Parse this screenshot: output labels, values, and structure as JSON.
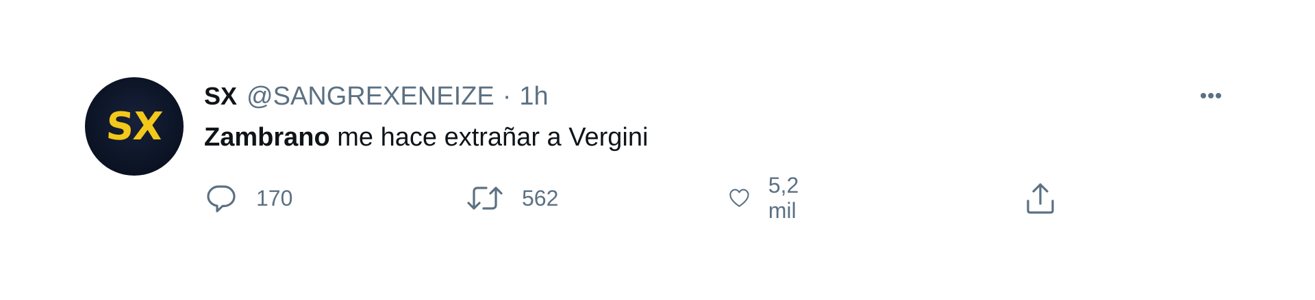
{
  "tweet": {
    "avatar_text": "SX",
    "display_name": "SX",
    "handle": "@SANGREXENEIZE",
    "separator": "·",
    "time": "1h",
    "body_bold": "Zambrano",
    "body_rest": " me hace extrañar a Vergini"
  },
  "actions": {
    "replies": "170",
    "retweets": "562",
    "likes": "5,2 mil"
  },
  "icons": {
    "more": "more-horizontal-icon",
    "reply": "reply-icon",
    "retweet": "retweet-icon",
    "like": "like-icon",
    "share": "share-icon"
  },
  "colors": {
    "primary_text": "#0f1419",
    "secondary_text": "#5b7083",
    "avatar_bg": "#0c1426",
    "avatar_text": "#f2c81a"
  }
}
